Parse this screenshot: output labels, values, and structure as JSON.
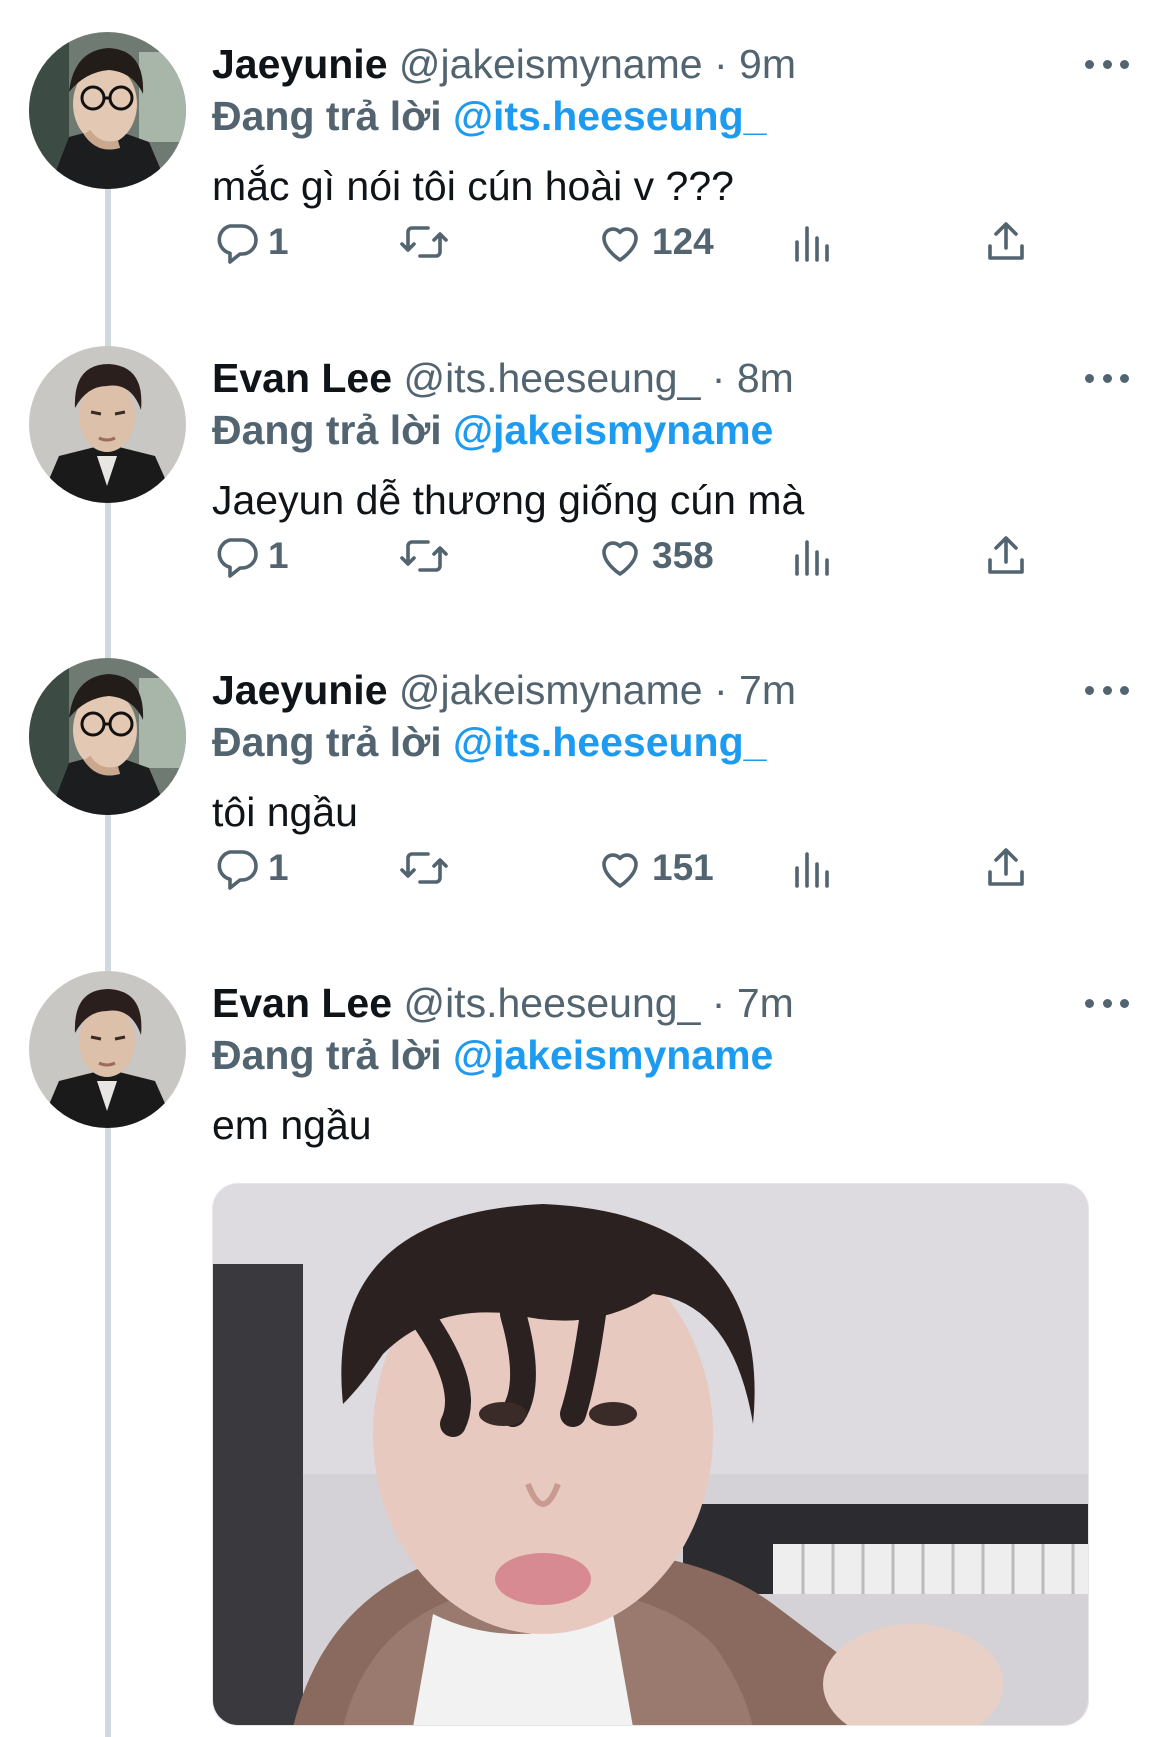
{
  "reply_prefix": "Đang trả lời",
  "tweets": [
    {
      "name": "Jaeyunie",
      "handle": "@jakeismyname",
      "time": "· 9m",
      "reply_to": "@its.heeseung_",
      "text": "mắc gì nói tôi cún hoài v ???",
      "replies": "1",
      "likes": "124"
    },
    {
      "name": "Evan Lee",
      "handle": "@its.heeseung_",
      "time": "· 8m",
      "reply_to": "@jakeismyname",
      "text": "Jaeyun dễ thương giống cún mà",
      "replies": "1",
      "likes": "358"
    },
    {
      "name": "Jaeyunie",
      "handle": "@jakeismyname",
      "time": "· 7m",
      "reply_to": "@its.heeseung_",
      "text": "tôi ngầu",
      "replies": "1",
      "likes": "151"
    },
    {
      "name": "Evan Lee",
      "handle": "@its.heeseung_",
      "time": "· 7m",
      "reply_to": "@jakeismyname",
      "text": "em ngầu"
    }
  ],
  "icons": {
    "reply": "reply-icon",
    "retweet": "retweet-icon",
    "like": "heart-icon",
    "views": "views-icon",
    "share": "share-icon",
    "more": "more-icon"
  },
  "colors": {
    "link": "#1d9bf0",
    "secondary": "#536471",
    "thread_line": "#cfd9de"
  }
}
